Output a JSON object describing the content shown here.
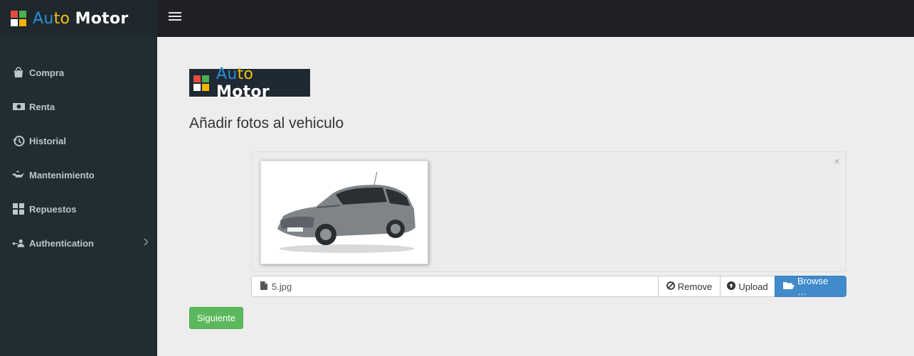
{
  "brand": {
    "name_part1": "Au",
    "name_part2": "to",
    "name_part3": "Motor",
    "logo_colors": [
      "#e74c3c",
      "#4caf50",
      "#ffffff",
      "#f4b400"
    ]
  },
  "sidebar": {
    "items": [
      {
        "label": "Compra",
        "icon": "shopping-bag-icon"
      },
      {
        "label": "Renta",
        "icon": "money-icon"
      },
      {
        "label": "Historial",
        "icon": "history-icon"
      },
      {
        "label": "Mantenimiento",
        "icon": "oil-can-icon"
      },
      {
        "label": "Repuestos",
        "icon": "grid-icon"
      },
      {
        "label": "Authentication",
        "icon": "user-key-icon",
        "has_submenu": true
      }
    ]
  },
  "main": {
    "title": "Añadir fotos al vehiculo",
    "file_input": {
      "filename": "5.jpg",
      "remove_label": "Remove",
      "upload_label": "Upload",
      "browse_label": "Browse …"
    },
    "preview_close": "×",
    "next_label": "Siguiente"
  },
  "colors": {
    "sidebar_bg": "#222d32",
    "topbar_bg": "#1f2124",
    "browse_blue": "#428bca",
    "next_green": "#5cb85c"
  }
}
